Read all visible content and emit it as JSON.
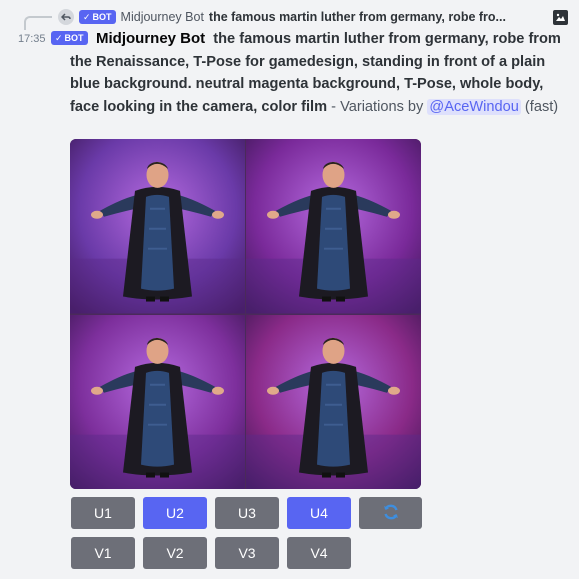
{
  "reply": {
    "bot_badge": "BOT",
    "author": "Midjourney Bot",
    "snippet": "the famous martin luther from germany, robe fro..."
  },
  "message": {
    "timestamp": "17:35",
    "bot_badge": "BOT",
    "author": "Midjourney Bot",
    "prompt": "the famous martin luther from germany, robe from the Renaissance, T-Pose for gamedesign, standing in front of a plain blue background. neutral magenta background, T-Pose, whole body, face looking in the camera, color film",
    "suffix": " - Variations by ",
    "mention": "@AceWindou",
    "mode": " (fast)"
  },
  "images": [
    {
      "icon": "t-pose-figure-image",
      "background": "#6a3aa8"
    },
    {
      "icon": "t-pose-figure-image",
      "background": "#7a2a9a"
    },
    {
      "icon": "t-pose-figure-image",
      "background": "#7d2f9c"
    },
    {
      "icon": "t-pose-figure-image",
      "background": "#8a2a88"
    }
  ],
  "buttons": {
    "row1": [
      {
        "label": "U1",
        "style": "secondary"
      },
      {
        "label": "U2",
        "style": "primary"
      },
      {
        "label": "U3",
        "style": "secondary"
      },
      {
        "label": "U4",
        "style": "primary"
      },
      {
        "label": "",
        "icon": "reroll-icon",
        "style": "secondary"
      }
    ],
    "row2": [
      {
        "label": "V1",
        "style": "secondary"
      },
      {
        "label": "V2",
        "style": "secondary"
      },
      {
        "label": "V3",
        "style": "secondary"
      },
      {
        "label": "V4",
        "style": "secondary"
      }
    ]
  },
  "colors": {
    "accent": "#5865f2",
    "secondary_button": "#6d6f78",
    "background": "#f2f3f5"
  }
}
